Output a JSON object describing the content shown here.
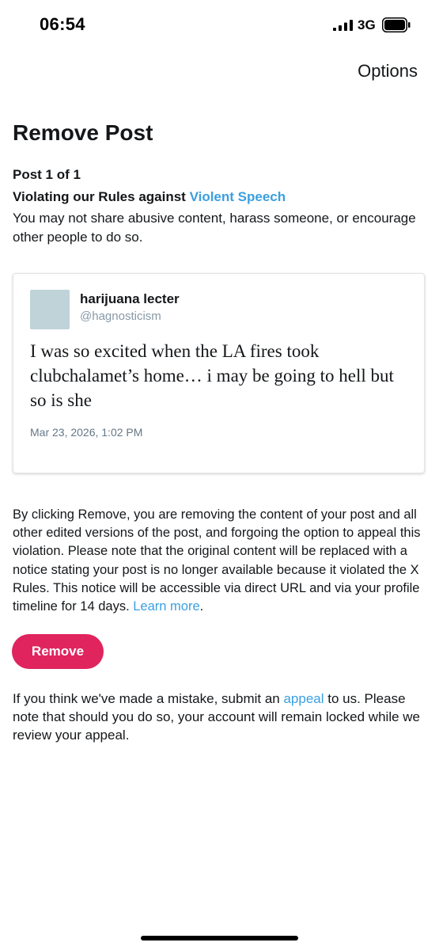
{
  "status_bar": {
    "time": "06:54",
    "network": "3G"
  },
  "header": {
    "options_label": "Options"
  },
  "page": {
    "title": "Remove Post",
    "post_count": "Post 1 of 1",
    "violation_prefix": "Violating our Rules against ",
    "violation_link": "Violent Speech",
    "violation_description": "You may not share abusive content, harass someone, or encourage other people to do so."
  },
  "tweet": {
    "name": "harijuana lecter",
    "handle": "@hagnosticism",
    "text": "I was so excited when the LA fires took clubchalamet’s home… i may be going to hell but so is she",
    "timestamp": "Mar 23, 2026, 1:02 PM"
  },
  "disclaimer": {
    "text": "By clicking Remove, you are removing the content of your post and all other edited versions of the post, and forgoing the option to appeal this violation. Please note that the original content will be replaced with a notice stating your post is no longer available because it violated the X Rules. This notice will be accessible via direct URL and via your profile timeline for 14 days. ",
    "learn_more": "Learn more",
    "suffix": "."
  },
  "actions": {
    "remove_label": "Remove"
  },
  "appeal": {
    "prefix": "If you think we've made a mistake, submit an ",
    "link": "appeal",
    "suffix": " to us. Please note that should you do so, your account will remain locked while we review your appeal."
  },
  "colors": {
    "link": "#3a9fe0",
    "remove_button": "#e0245e",
    "avatar": "#bfd3d9"
  }
}
